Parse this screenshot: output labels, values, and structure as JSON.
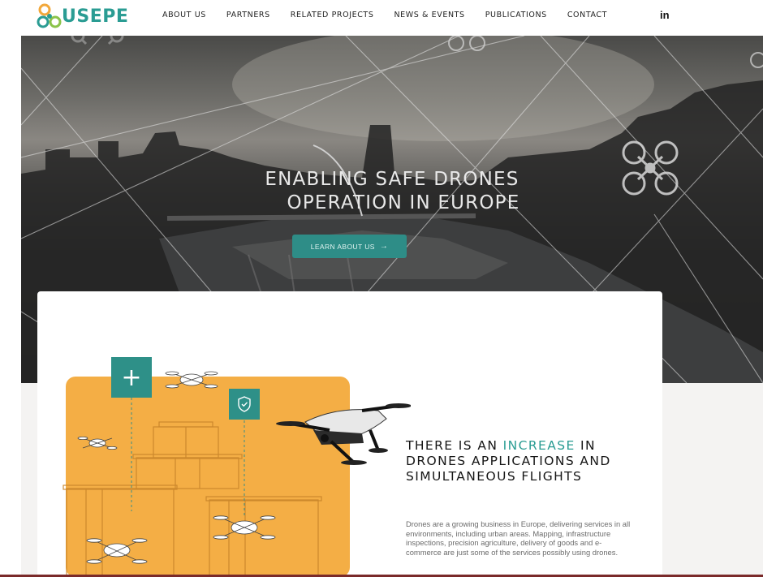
{
  "brand": {
    "logo_text": "USEPE",
    "accent_color": "#2a9c93"
  },
  "nav": {
    "items": [
      {
        "label": "ABOUT US"
      },
      {
        "label": "PARTNERS"
      },
      {
        "label": "RELATED PROJECTS"
      },
      {
        "label": "NEWS & EVENTS"
      },
      {
        "label": "PUBLICATIONS"
      },
      {
        "label": "CONTACT"
      }
    ],
    "social_icon": "linkedin-icon",
    "social_label": "in"
  },
  "hero": {
    "title_line1": "ENABLING SAFE DRONES",
    "title_line2": "OPERATION IN EUROPE",
    "button_label": "LEARN ABOUT US",
    "button_arrow": "→",
    "button_color": "#2e8d87"
  },
  "feature": {
    "plus_icon_glyph": "+",
    "headline_before": "THERE IS AN",
    "headline_accent": "INCREASE",
    "headline_after": "IN DRONES APPLICATIONS AND SIMULTANEOUS FLIGHTS",
    "description": "Drones are a growing business in Europe, delivering services in all environments, including urban areas. Mapping, infrastructure inspections, precision agriculture, delivery of goods and e-commerce are just some of the services possibly using drones.",
    "illustration_color": "#f4ae45",
    "icon_color": "#2e9088"
  }
}
